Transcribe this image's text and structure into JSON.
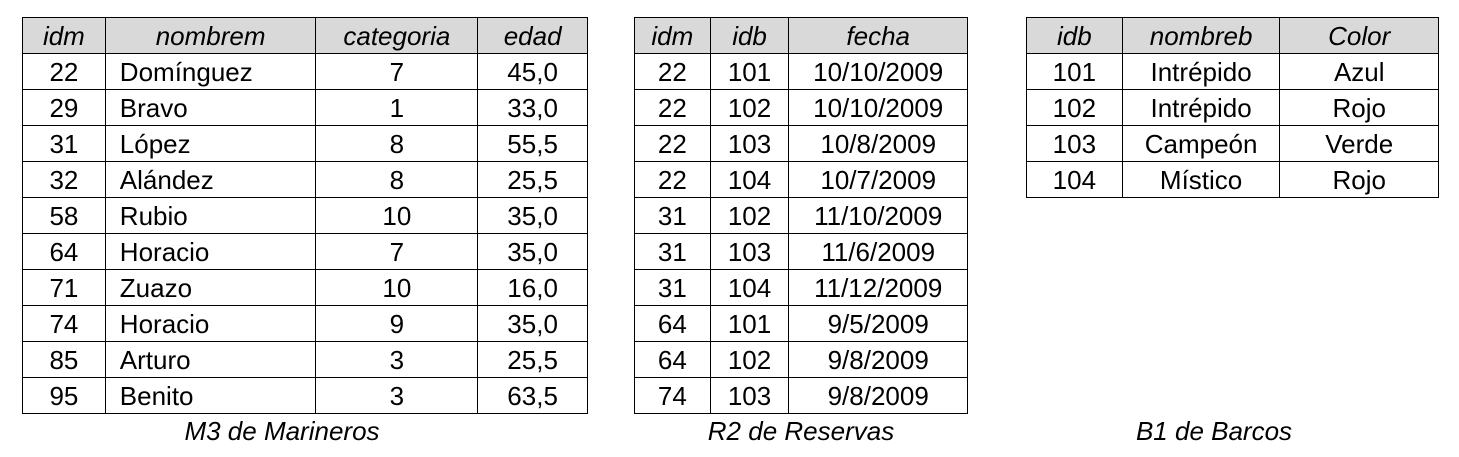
{
  "marineros": {
    "caption": "M3 de Marineros",
    "headers": [
      "idm",
      "nombrem",
      "categoria",
      "edad"
    ],
    "rows": [
      [
        "22",
        "Domínguez",
        "7",
        "45,0"
      ],
      [
        "29",
        "Bravo",
        "1",
        "33,0"
      ],
      [
        "31",
        "López",
        "8",
        "55,5"
      ],
      [
        "32",
        "Alández",
        "8",
        "25,5"
      ],
      [
        "58",
        "Rubio",
        "10",
        "35,0"
      ],
      [
        "64",
        "Horacio",
        "7",
        "35,0"
      ],
      [
        "71",
        "Zuazo",
        "10",
        "16,0"
      ],
      [
        "74",
        "Horacio",
        "9",
        "35,0"
      ],
      [
        "85",
        "Arturo",
        "3",
        "25,5"
      ],
      [
        "95",
        "Benito",
        "3",
        "63,5"
      ]
    ]
  },
  "reservas": {
    "caption": "R2 de Reservas",
    "headers": [
      "idm",
      "idb",
      "fecha"
    ],
    "rows": [
      [
        "22",
        "101",
        "10/10/2009"
      ],
      [
        "22",
        "102",
        "10/10/2009"
      ],
      [
        "22",
        "103",
        "10/8/2009"
      ],
      [
        "22",
        "104",
        "10/7/2009"
      ],
      [
        "31",
        "102",
        "11/10/2009"
      ],
      [
        "31",
        "103",
        "11/6/2009"
      ],
      [
        "31",
        "104",
        "11/12/2009"
      ],
      [
        "64",
        "101",
        "9/5/2009"
      ],
      [
        "64",
        "102",
        "9/8/2009"
      ],
      [
        "74",
        "103",
        "9/8/2009"
      ]
    ]
  },
  "barcos": {
    "caption": "B1 de Barcos",
    "headers": [
      "idb",
      "nombreb",
      "Color"
    ],
    "rows": [
      [
        "101",
        "Intrépido",
        "Azul"
      ],
      [
        "102",
        "Intrépido",
        "Rojo"
      ],
      [
        "103",
        "Campeón",
        "Verde"
      ],
      [
        "104",
        "Místico",
        "Rojo"
      ]
    ]
  }
}
